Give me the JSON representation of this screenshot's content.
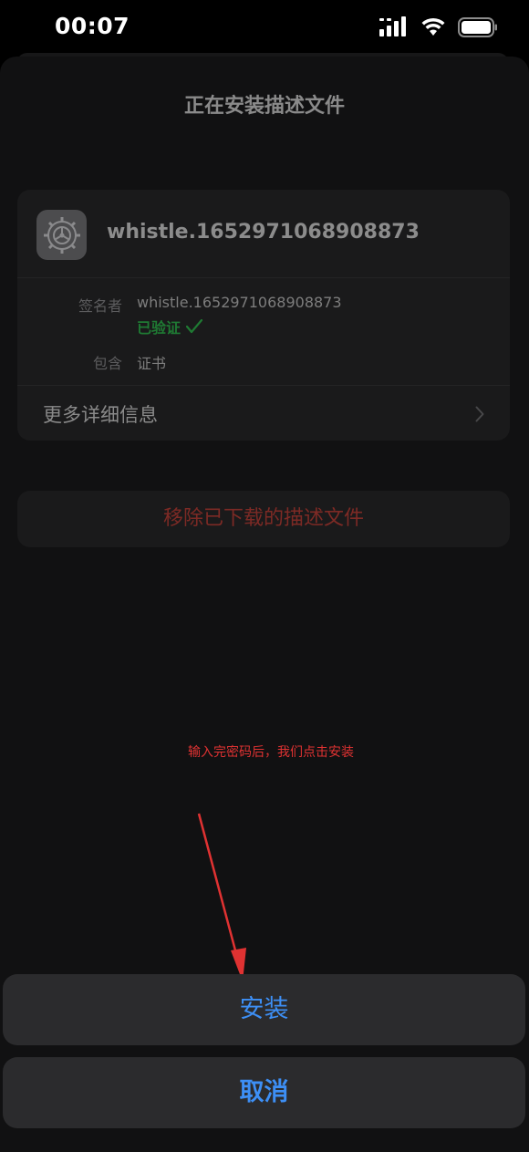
{
  "status_bar": {
    "time": "00:07"
  },
  "sheet": {
    "title": "正在安装描述文件"
  },
  "profile": {
    "icon": "settings-gear-icon",
    "name": "whistle.1652971068908873",
    "signer_label": "签名者",
    "signer_value": "whistle.1652971068908873",
    "verified_text": "已验证",
    "contains_label": "包含",
    "contains_value": "证书",
    "more_details_label": "更多详细信息"
  },
  "remove_button_label": "移除已下载的描述文件",
  "annotation": {
    "text": "输入完密码后，我们点击安装",
    "color": "#e03232"
  },
  "action_sheet": {
    "install_label": "安装",
    "cancel_label": "取消",
    "accent_color": "#3d8ff5"
  }
}
